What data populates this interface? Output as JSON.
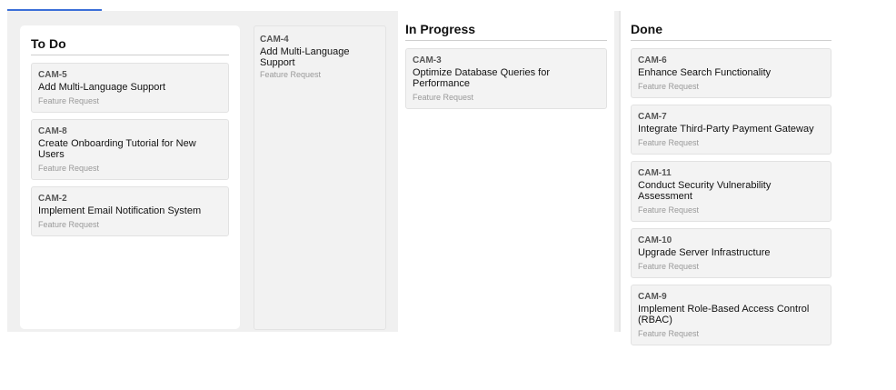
{
  "board": {
    "columns": [
      {
        "title": "To Do",
        "cards": [
          {
            "id": "CAM-5",
            "title": "Add Multi-Language Support",
            "type": "Feature Request"
          },
          {
            "id": "CAM-8",
            "title": "Create Onboarding Tutorial for New Users",
            "type": "Feature Request"
          },
          {
            "id": "CAM-2",
            "title": "Implement Email Notification System",
            "type": "Feature Request"
          }
        ]
      },
      {
        "title": "In Progress",
        "cards": [
          {
            "id": "CAM-3",
            "title": "Optimize Database Queries for Performance",
            "type": "Feature Request"
          }
        ]
      },
      {
        "title": "Done",
        "cards": [
          {
            "id": "CAM-6",
            "title": "Enhance Search Functionality",
            "type": "Feature Request"
          },
          {
            "id": "CAM-7",
            "title": "Integrate Third-Party Payment Gateway",
            "type": "Feature Request"
          },
          {
            "id": "CAM-11",
            "title": "Conduct Security Vulnerability Assessment",
            "type": "Feature Request"
          },
          {
            "id": "CAM-10",
            "title": "Upgrade Server Infrastructure",
            "type": "Feature Request"
          },
          {
            "id": "CAM-9",
            "title": "Implement Role-Based Access Control (RBAC)",
            "type": "Feature Request"
          }
        ]
      }
    ],
    "dragging_card": {
      "id": "CAM-4",
      "title": "Add Multi-Language Support",
      "type": "Feature Request"
    }
  }
}
